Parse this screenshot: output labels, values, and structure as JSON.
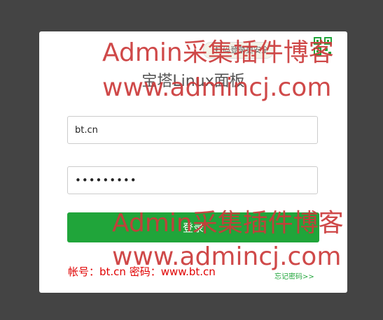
{
  "qr_tip": "扫码登录更安全",
  "title": "宝塔Linux面板",
  "username": {
    "value": "bt.cn"
  },
  "password": {
    "value": "•••••••••"
  },
  "login_button": "登录",
  "hint": "帐号：bt.cn 密码：www.bt.cn",
  "forgot": "忘记密码>>",
  "watermark": {
    "brand": "Admin采集插件博客",
    "url": "www.admincj.com"
  },
  "colors": {
    "background": "#444444",
    "accent": "#20a53a",
    "hint": "#e00000",
    "watermark": "#cc3a3a"
  }
}
